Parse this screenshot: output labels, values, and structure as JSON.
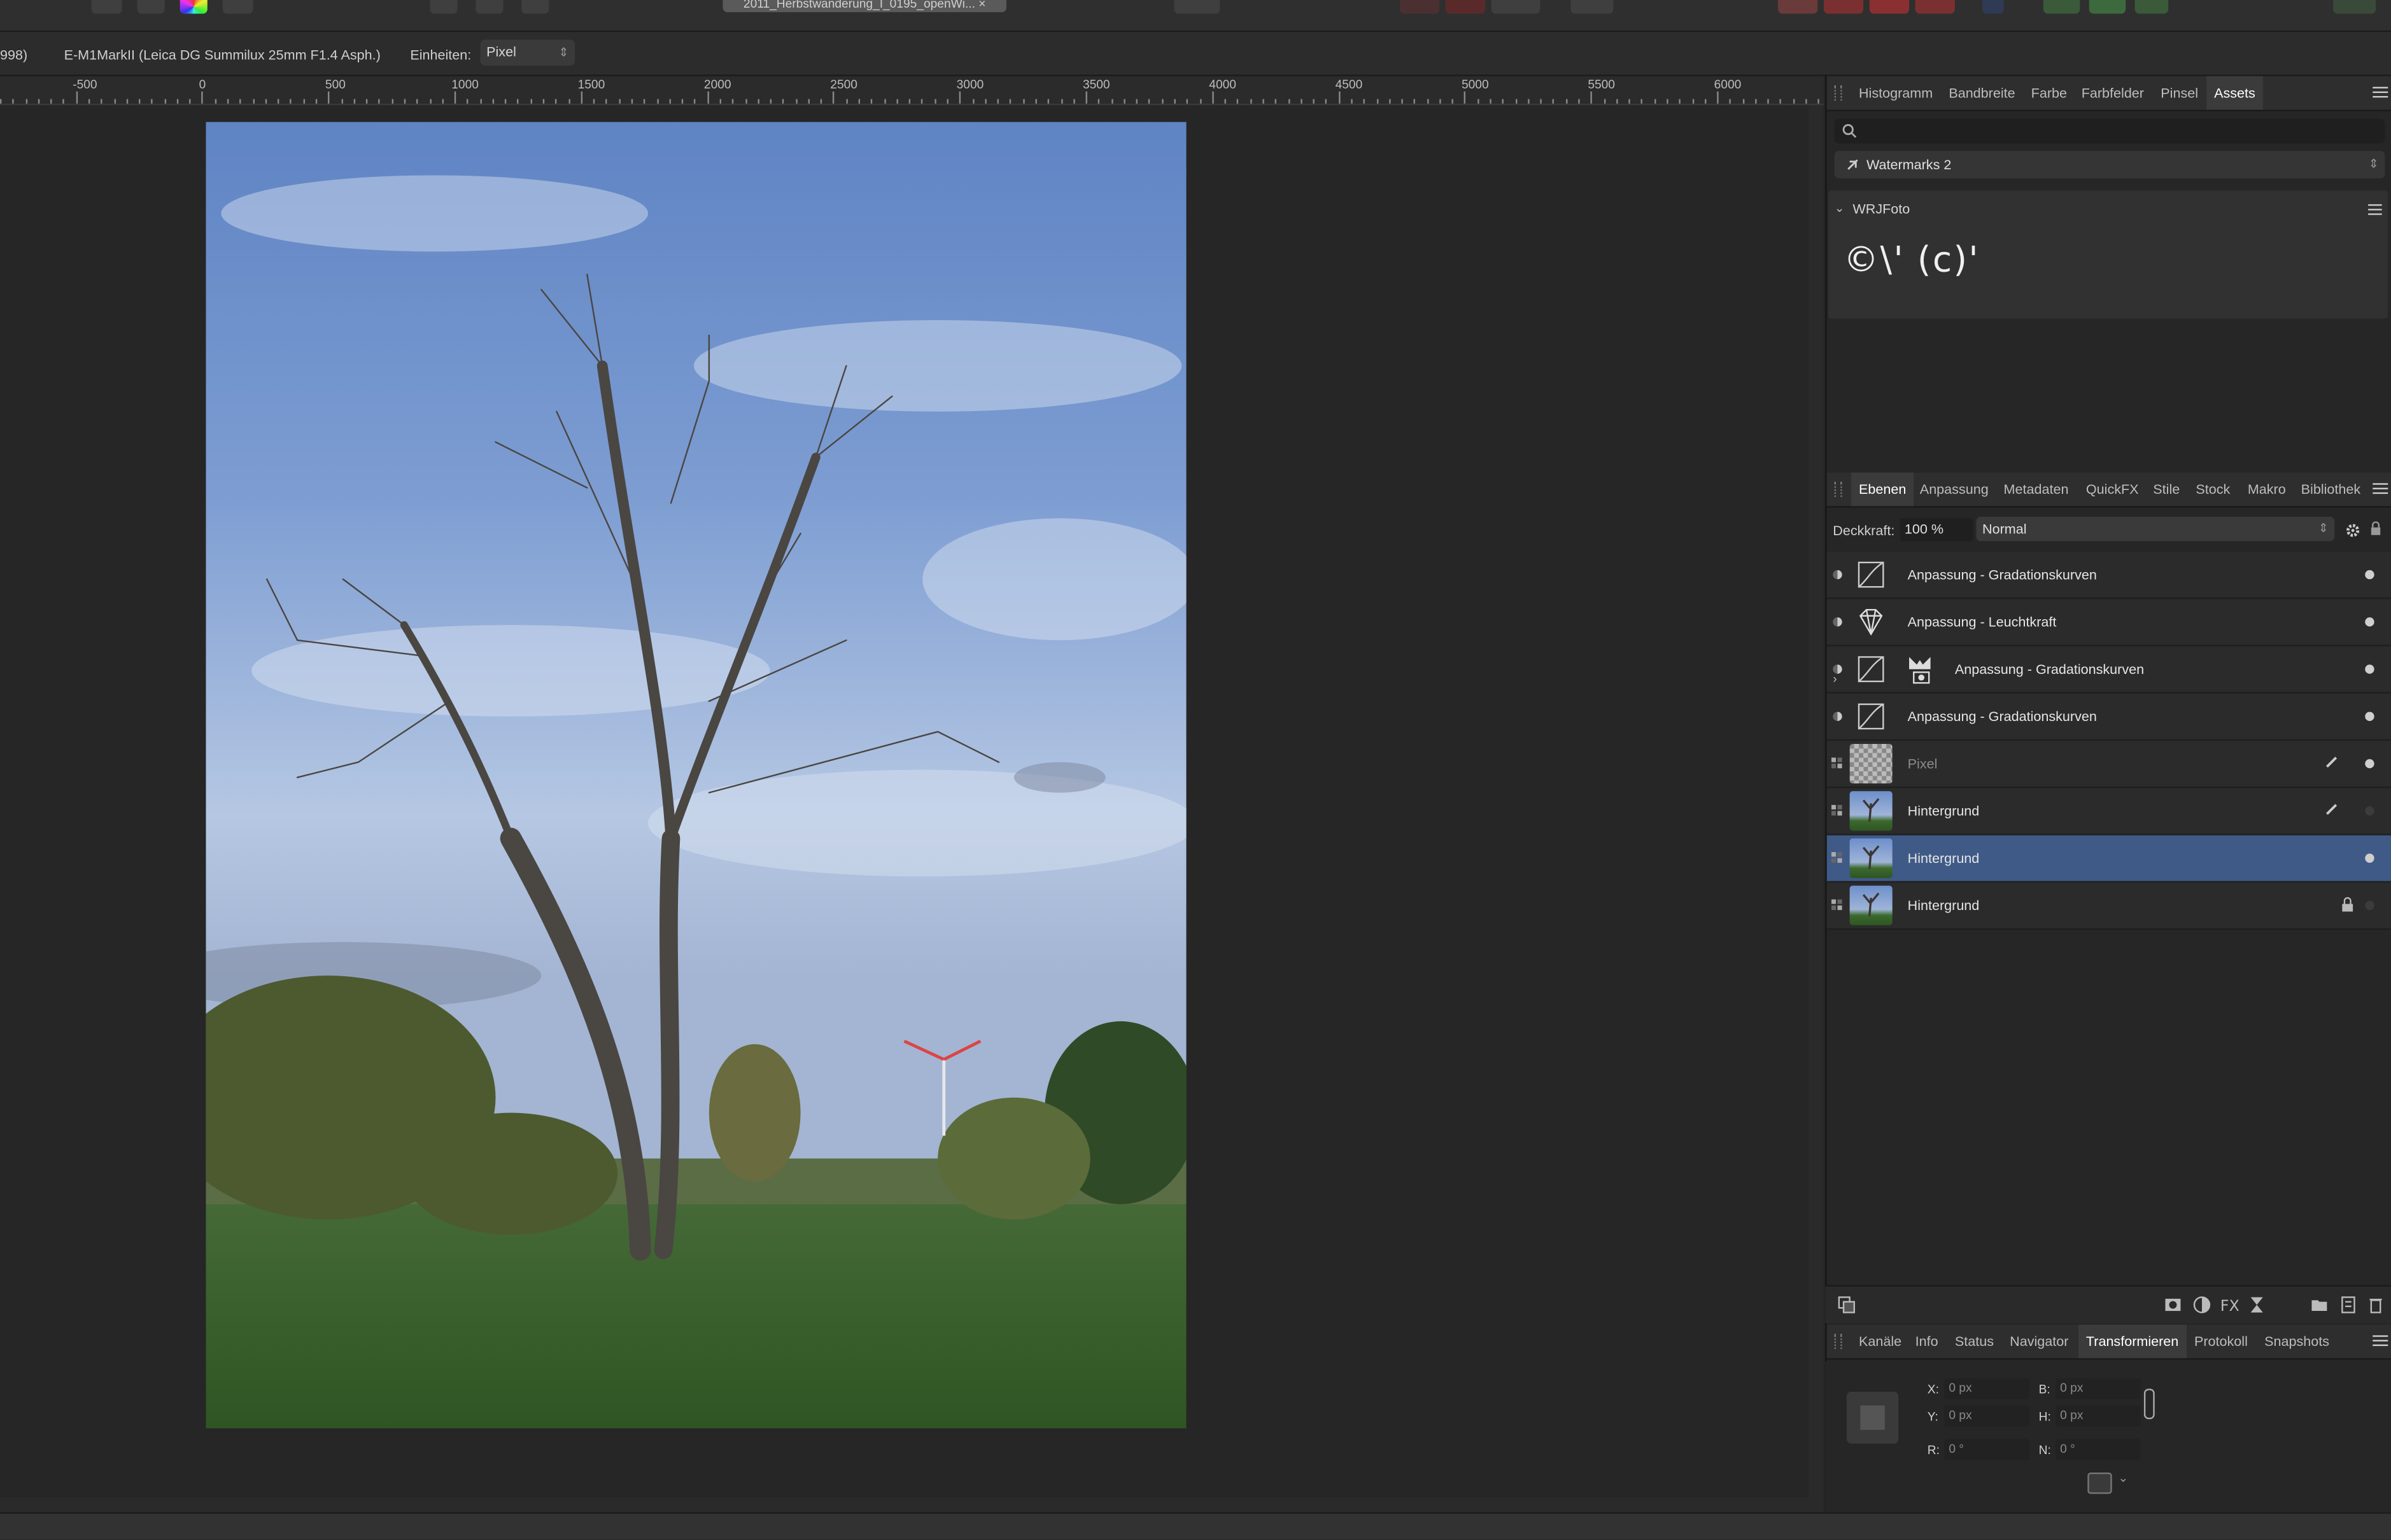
{
  "document": {
    "tab_title": "2011_Herbstwanderung_I_0195_openWi... ×"
  },
  "context_bar": {
    "info_left": "998)",
    "lens": "E-M1MarkII (Leica DG Summilux 25mm F1.4 Asph.)",
    "units_label": "Einheiten:",
    "units_value": "Pixel"
  },
  "ruler": {
    "labels": [
      "-500",
      "0",
      "500",
      "1000",
      "1500",
      "2000",
      "2500",
      "3000",
      "3500",
      "4000",
      "4500",
      "5000",
      "5500",
      "6000"
    ]
  },
  "top_panel": {
    "tabs": [
      "Histogramm",
      "Bandbreite",
      "Farbe",
      "Farbfelder",
      "Pinsel",
      "Assets"
    ],
    "active_tab": "Assets",
    "search_placeholder": "",
    "category": "Watermarks 2",
    "section_title": "WRJFoto",
    "asset_preview": "©\\' (c)'"
  },
  "layers_panel": {
    "tabs": [
      "Ebenen",
      "Anpassung",
      "Metadaten",
      "QuickFX",
      "Stile",
      "Stock",
      "Makro",
      "Bibliothek"
    ],
    "active_tab": "Ebenen",
    "opacity_label": "Deckkraft:",
    "opacity_value": "100 %",
    "blend_mode": "Normal",
    "layers": [
      {
        "name": "Anpassung - Gradationskurven",
        "type": "curves",
        "visible": true
      },
      {
        "name": "Anpassung - Leuchtkraft",
        "type": "vibrance",
        "visible": true
      },
      {
        "name": "Anpassung - Gradationskurven",
        "type": "curves-group",
        "visible": true
      },
      {
        "name": "Anpassung - Gradationskurven",
        "type": "curves",
        "visible": true
      },
      {
        "name": "Pixel",
        "type": "pixel",
        "visible": true
      },
      {
        "name": "Hintergrund",
        "type": "image",
        "visible": false
      },
      {
        "name": "Hintergrund",
        "type": "image",
        "visible": true,
        "selected": true
      },
      {
        "name": "Hintergrund",
        "type": "image",
        "visible": false,
        "locked": true
      }
    ]
  },
  "bottom_panel": {
    "tabs": [
      "Kanäle",
      "Info",
      "Status",
      "Navigator",
      "Transformieren",
      "Protokoll",
      "Snapshots"
    ],
    "active_tab": "Transformieren",
    "fields": {
      "x_label": "X:",
      "x_value": "0 px",
      "y_label": "Y:",
      "y_value": "0 px",
      "b_label": "B:",
      "b_value": "0 px",
      "h_label": "H:",
      "h_value": "0 px",
      "r_label": "R:",
      "r_value": "0 °",
      "n_label": "N:",
      "n_value": "0 °"
    }
  },
  "colors": {
    "selection": "#3f5a87",
    "panel_bg": "#262626",
    "sky_top": "#6e8fc9",
    "grass": "#3d6b2e"
  }
}
